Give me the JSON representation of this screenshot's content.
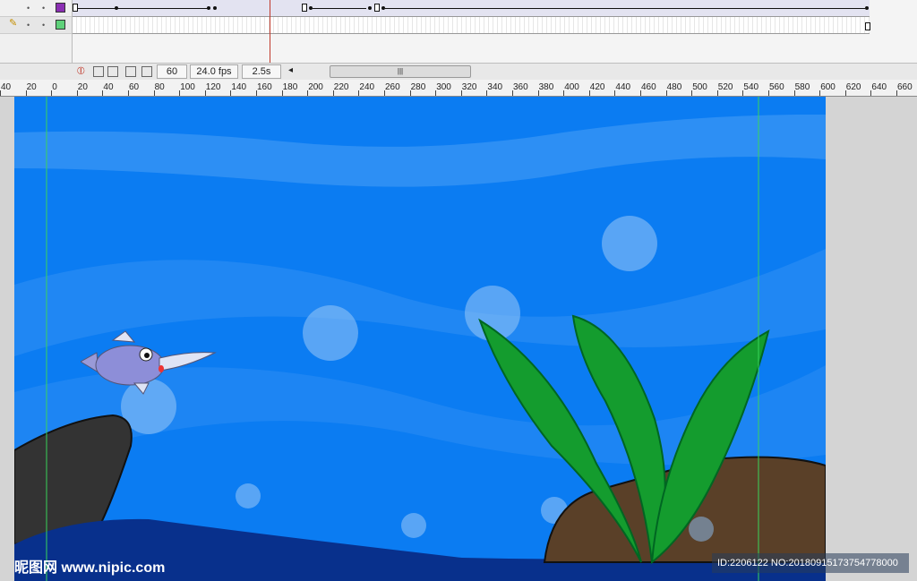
{
  "timeline": {
    "controls": {
      "frame": "60",
      "fps": "24.0 fps",
      "time": "2.5s"
    },
    "scroll_grip": "|||"
  },
  "ruler": {
    "labels": [
      "40",
      "20",
      "0",
      "20",
      "40",
      "60",
      "80",
      "100",
      "120",
      "140",
      "160",
      "180",
      "200",
      "220",
      "240",
      "260",
      "280",
      "300",
      "320",
      "340",
      "360",
      "380",
      "400",
      "420",
      "440",
      "460",
      "480",
      "500",
      "520",
      "540",
      "560",
      "580",
      "600",
      "620",
      "640",
      "660"
    ]
  },
  "colors": {
    "stage_bg": "#0b7cf2",
    "layer1": "#8b2fb3",
    "layer2": "#5fd17a",
    "playhead": "#c0392b"
  },
  "watermark": {
    "left": "昵图网 www.nipic.com",
    "right": "ID:2206122 NO:20180915173754778000"
  }
}
